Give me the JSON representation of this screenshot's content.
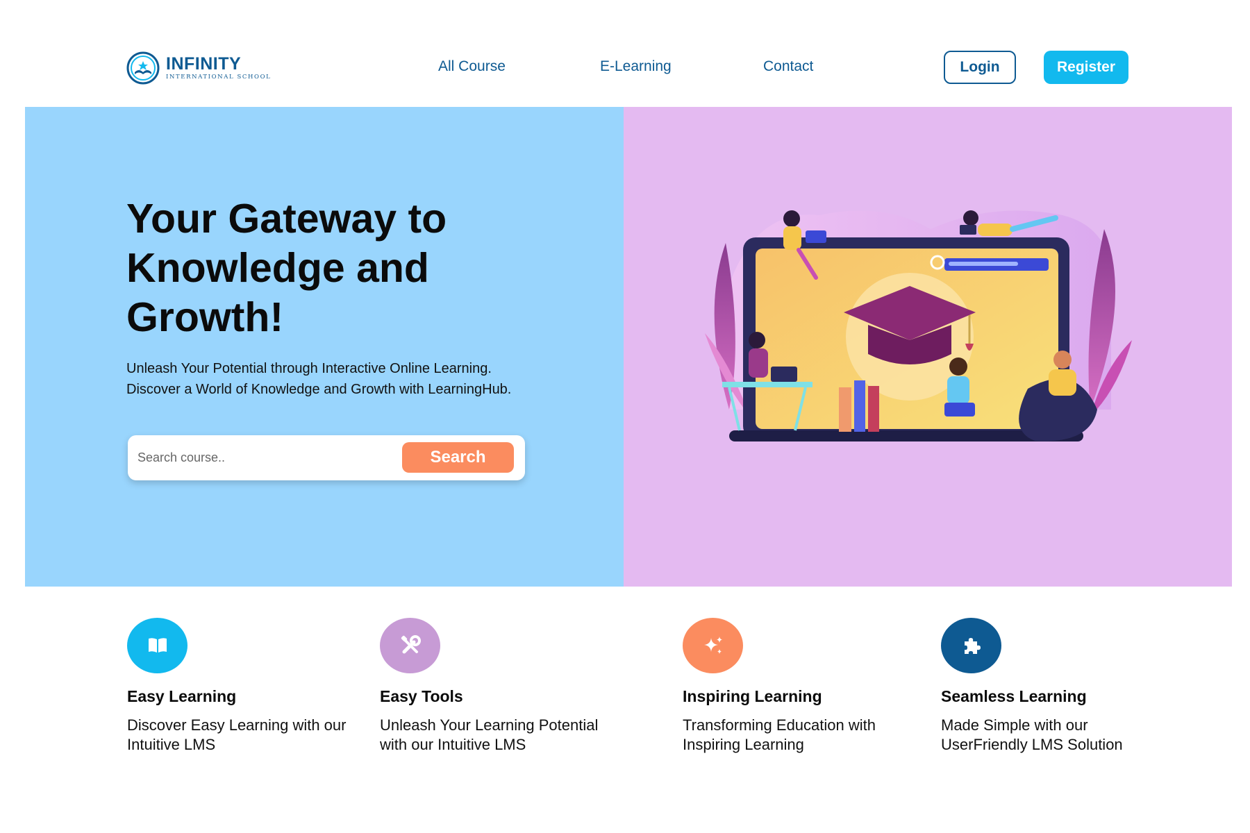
{
  "brand": {
    "name": "INFINITY",
    "subtitle": "INTERNATIONAL SCHOOL"
  },
  "nav": {
    "items": [
      {
        "label": "All Course"
      },
      {
        "label": "E-Learning"
      },
      {
        "label": "Contact"
      }
    ],
    "login_label": "Login",
    "register_label": "Register"
  },
  "hero": {
    "title": "Your Gateway to Knowledge and Growth!",
    "subtitle_line1": "Unleash Your Potential through Interactive Online Learning.",
    "subtitle_line2": "Discover a World of Knowledge and Growth with LearningHub.",
    "search": {
      "placeholder": "Search course..",
      "value": "",
      "button_label": "Search"
    }
  },
  "features": [
    {
      "title": "Easy Learning",
      "description": "Discover Easy Learning with our Intuitive LMS",
      "icon": "book-icon",
      "color": "#12b9ee"
    },
    {
      "title": "Easy Tools",
      "description": "Unleash Your Learning Potential with our Intuitive LMS",
      "icon": "tools-icon",
      "color": "#c79bd5"
    },
    {
      "title": "Inspiring Learning",
      "description": "Transforming Education with Inspiring Learning",
      "icon": "sparkles-icon",
      "color": "#fb8c5f"
    },
    {
      "title": "Seamless Learning",
      "description": "Made Simple with our UserFriendly LMS Solution",
      "icon": "puzzle-icon",
      "color": "#0e5a92"
    }
  ],
  "colors": {
    "brand_blue": "#0e5a92",
    "accent_cyan": "#12b9ee",
    "hero_left_bg": "#99d5fd",
    "hero_right_bg": "#e4baf1",
    "search_button": "#fb8c5f"
  }
}
